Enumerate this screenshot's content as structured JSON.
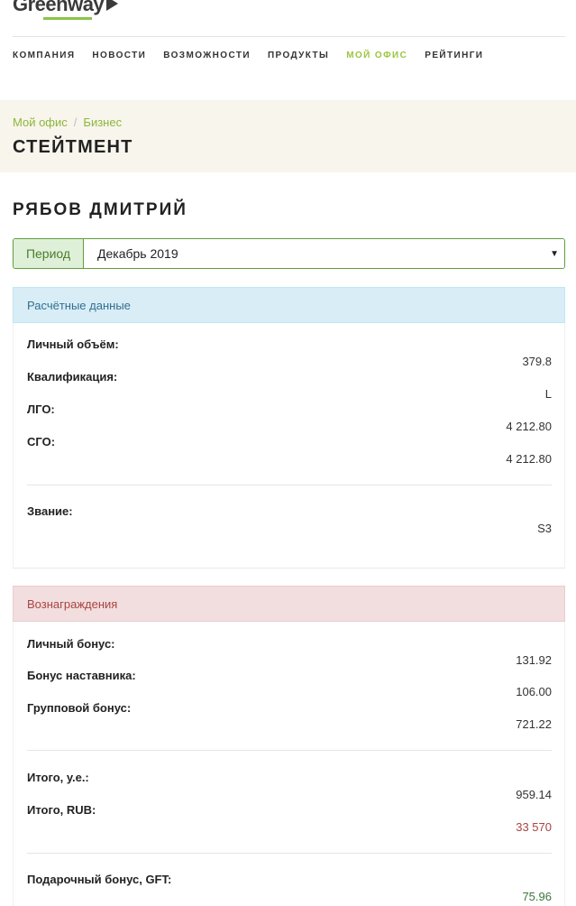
{
  "header": {
    "logo_text": "Greenway",
    "nav": [
      {
        "label": "КОМПАНИЯ",
        "active": false
      },
      {
        "label": "НОВОСТИ",
        "active": false
      },
      {
        "label": "ВОЗМОЖНОСТИ",
        "active": false
      },
      {
        "label": "ПРОДУКТЫ",
        "active": false
      },
      {
        "label": "МОЙ ОФИС",
        "active": true
      },
      {
        "label": "РЕЙТИНГИ",
        "active": false
      }
    ]
  },
  "breadcrumb": {
    "items": [
      "Мой офис",
      "Бизнес"
    ],
    "separator": "/"
  },
  "page_title": "СТЕЙТМЕНТ",
  "user_name": "РЯБОВ ДМИТРИЙ",
  "period": {
    "label": "Период",
    "selected": "Декабрь 2019",
    "caret": "▼"
  },
  "calc": {
    "title": "Расчётные данные",
    "rows": [
      {
        "label": "Личный объём:",
        "value": "379.8"
      },
      {
        "label": "Квалификация:",
        "value": "L"
      },
      {
        "label": "ЛГО:",
        "value": "4 212.80"
      },
      {
        "label": "СГО:",
        "value": "4 212.80"
      },
      {
        "label": "Звание:",
        "value": "S3"
      }
    ]
  },
  "rewards": {
    "title": "Вознаграждения",
    "rows": [
      {
        "label": "Личный бонус:",
        "value": "131.92"
      },
      {
        "label": "Бонус наставника:",
        "value": "106.00"
      },
      {
        "label": "Групповой бонус:",
        "value": "721.22"
      },
      {
        "label": "Итого, у.е.:",
        "value": "959.14"
      },
      {
        "label": "Итого, RUB:",
        "value": "33 570"
      },
      {
        "label": "Подарочный бонус, GFT:",
        "value": "75.96"
      }
    ]
  },
  "colors": {
    "accent_green": "#9bc53d",
    "info_bg": "#d9edf7",
    "danger_bg": "#f2dede",
    "success_bg": "#dff0d8"
  }
}
